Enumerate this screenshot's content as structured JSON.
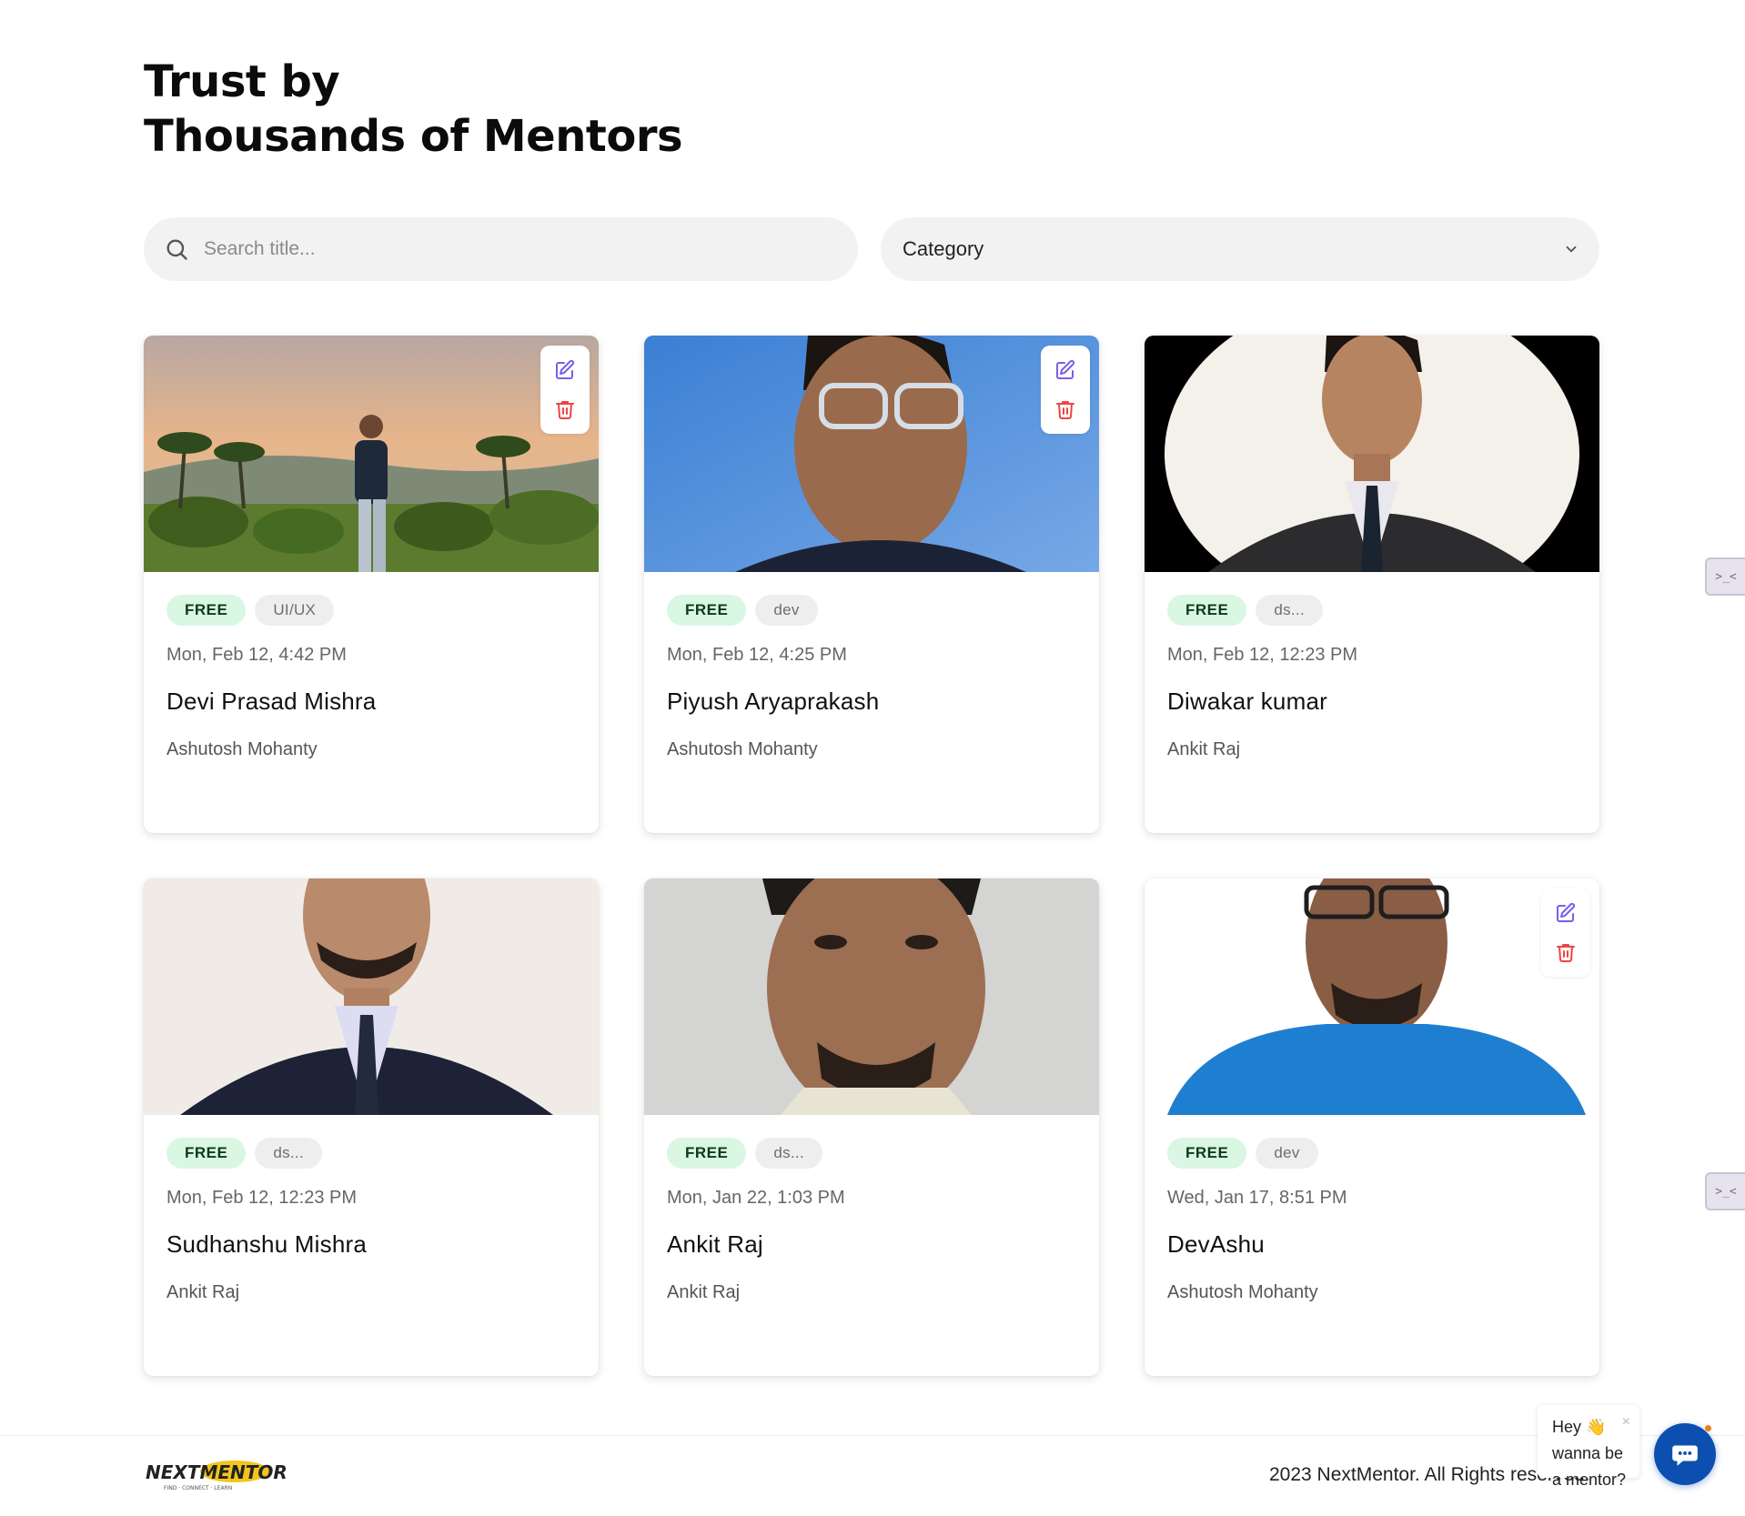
{
  "heading": {
    "line1": "Trust by",
    "line2": "Thousands of Mentors"
  },
  "search": {
    "placeholder": "Search title..."
  },
  "category": {
    "label": "Category"
  },
  "cards": [
    {
      "price": "FREE",
      "category": "UI/UX",
      "date": "Mon, Feb 12, 4:42 PM",
      "name": "Devi Prasad Mishra",
      "mentor": "Ashutosh Mohanty",
      "has_actions": true
    },
    {
      "price": "FREE",
      "category": "dev",
      "date": "Mon, Feb 12, 4:25 PM",
      "name": "Piyush Aryaprakash",
      "mentor": "Ashutosh Mohanty",
      "has_actions": true
    },
    {
      "price": "FREE",
      "category": "ds...",
      "date": "Mon, Feb 12, 12:23 PM",
      "name": "Diwakar kumar",
      "mentor": "Ankit Raj",
      "has_actions": false
    },
    {
      "price": "FREE",
      "category": "ds...",
      "date": "Mon, Feb 12, 12:23 PM",
      "name": "Sudhanshu Mishra",
      "mentor": "Ankit Raj",
      "has_actions": false
    },
    {
      "price": "FREE",
      "category": "ds...",
      "date": "Mon, Jan 22, 1:03 PM",
      "name": "Ankit Raj",
      "mentor": "Ankit Raj",
      "has_actions": false
    },
    {
      "price": "FREE",
      "category": "dev",
      "date": "Wed, Jan 17, 8:51 PM",
      "name": "DevAshu",
      "mentor": "Ashutosh Mohanty",
      "has_actions": true
    }
  ],
  "side_tabs": [
    {
      "label": ">_<"
    },
    {
      "label": ">_<"
    }
  ],
  "footer": {
    "logo_text": "NEXTMENTOR",
    "logo_tagline": "FIND · CONNECT · LEARN",
    "copyright": "2023 NextMentor. All Rights reserved."
  },
  "chat": {
    "message": "Hey 👋 wanna be a mentor?",
    "close": "×"
  },
  "colors": {
    "free_tag_bg": "#d9f7e2",
    "edit_icon": "#7b5cf0",
    "delete_icon": "#ef4444",
    "chat_button": "#0d4fb0"
  },
  "icons": {
    "search": "search-icon",
    "dropdown": "chevron-down-icon",
    "edit": "edit-icon",
    "delete": "trash-icon",
    "chat": "chat-icon"
  }
}
